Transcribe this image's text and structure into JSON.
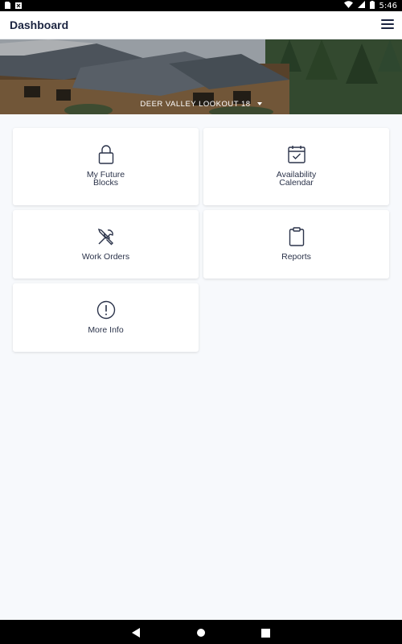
{
  "status_bar": {
    "time": "5:46"
  },
  "app_bar": {
    "title": "Dashboard"
  },
  "hero": {
    "property_name": "DEER VALLEY LOOKOUT 18"
  },
  "tiles": [
    {
      "label": "My Future\nBlocks",
      "icon": "lock-icon"
    },
    {
      "label": "Availability\nCalendar",
      "icon": "calendar-check-icon"
    },
    {
      "label": "Work Orders",
      "icon": "tools-icon"
    },
    {
      "label": "Reports",
      "icon": "clipboard-icon"
    },
    {
      "label": "More Info",
      "icon": "info-circle-icon"
    }
  ],
  "colors": {
    "accent": "#1b2440",
    "background": "#f7f9fc",
    "card": "#ffffff"
  }
}
